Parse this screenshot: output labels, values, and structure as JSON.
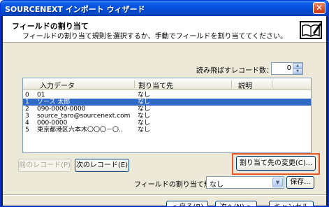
{
  "window": {
    "title": "SOURCENEXT インポート ウィザード",
    "close_glyph": "✕"
  },
  "header": {
    "title": "フィールドの割り当て",
    "description": "フィールドの割り当て規則を選択するか、手動でフィールドを割り当ててください。"
  },
  "skip": {
    "label": "読み飛ばすレコード数：",
    "value": "0"
  },
  "list": {
    "columns": [
      "入力データ",
      "割り当て先",
      "説明"
    ],
    "rows": [
      {
        "index": "0",
        "input": "01",
        "target": "なし"
      },
      {
        "index": "1",
        "input": "ソース 太郎",
        "target": "なし",
        "selected": true
      },
      {
        "index": "2",
        "input": "090-0000-0000",
        "target": "なし"
      },
      {
        "index": "3",
        "input": "source_taro@sourcenext.com",
        "target": "なし"
      },
      {
        "index": "4",
        "input": "000-0000",
        "target": "なし"
      },
      {
        "index": "5",
        "input": "東京都港区六本木〇〇〇－〇..",
        "target": "なし"
      }
    ]
  },
  "buttons": {
    "prev_record": "前のレコード(P)",
    "next_record": "次のレコード(E)",
    "change_target": "割り当て先の変更(C)...",
    "save": "保存...",
    "back": "< 戻る(B)",
    "next": "次へ(N) >",
    "cancel": "キャンセル"
  },
  "rule": {
    "label": "フィールドの割り当て規",
    "value": "なし"
  },
  "colors": {
    "selection": "#316ac5",
    "highlight_box": "#e8572a",
    "titlebar": "#0652dd"
  }
}
